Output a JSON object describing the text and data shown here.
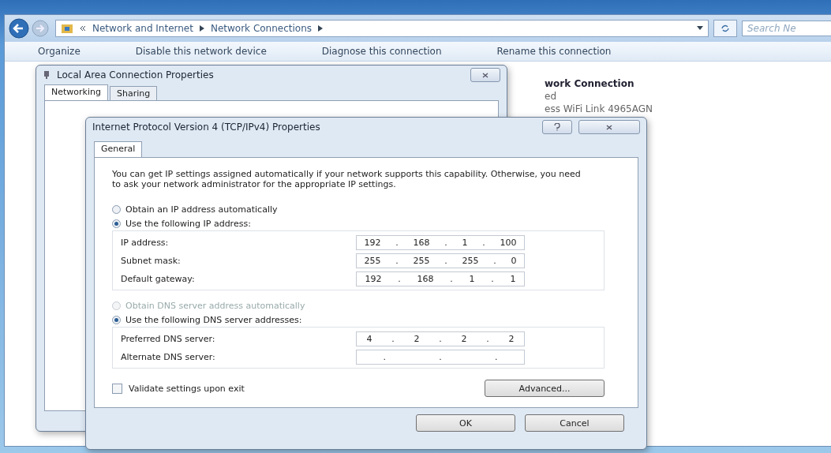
{
  "explorer": {
    "breadcrumb": [
      "Network and Internet",
      "Network Connections"
    ],
    "search": {
      "placeholder": "Search Ne"
    },
    "toolbar": [
      "Organize",
      "Disable this network device",
      "Diagnose this connection",
      "Rename this connection"
    ],
    "details": [
      "work Connection",
      "ed",
      "ess WiFi Link 4965AGN"
    ]
  },
  "lan_dialog": {
    "title": "Local Area Connection Properties",
    "tabs": [
      {
        "label": "Networking",
        "selected": true
      },
      {
        "label": "Sharing",
        "selected": false
      }
    ]
  },
  "ipv4_dialog": {
    "title": "Internet Protocol Version 4 (TCP/IPv4) Properties",
    "tabs": [
      {
        "label": "General",
        "selected": true
      }
    ],
    "intro": "You can get IP settings assigned automatically if your network supports this capability. Otherwise, you need to ask your network administrator for the appropriate IP settings.",
    "sections": [
      {
        "options": [
          {
            "label": "Obtain an IP address automatically",
            "selected": false,
            "disabled": false
          },
          {
            "label": "Use the following IP address:",
            "selected": true,
            "disabled": false
          }
        ],
        "fields": [
          {
            "label": "IP address:",
            "parts": [
              "192",
              ".",
              "168",
              ".",
              "1",
              ".",
              "100"
            ]
          },
          {
            "label": "Subnet mask:",
            "parts": [
              "255",
              ".",
              "255",
              ".",
              "255",
              ".",
              "0"
            ]
          },
          {
            "label": "Default gateway:",
            "parts": [
              "192",
              ".",
              "168",
              ".",
              "1",
              ".",
              "1"
            ]
          }
        ]
      },
      {
        "options": [
          {
            "label": "Obtain DNS server address automatically",
            "selected": false,
            "disabled": true
          },
          {
            "label": "Use the following DNS server addresses:",
            "selected": true,
            "disabled": false
          }
        ],
        "fields": [
          {
            "label": "Preferred DNS server:",
            "parts": [
              "4",
              ".",
              "2",
              ".",
              "2",
              ".",
              "2"
            ]
          },
          {
            "label": "Alternate DNS server:",
            "parts": [
              ".",
              ".",
              "."
            ]
          }
        ]
      }
    ],
    "validate": {
      "label": "Validate settings upon exit",
      "checked": false
    },
    "advanced": "Advanced...",
    "buttons": [
      "OK",
      "Cancel"
    ]
  }
}
